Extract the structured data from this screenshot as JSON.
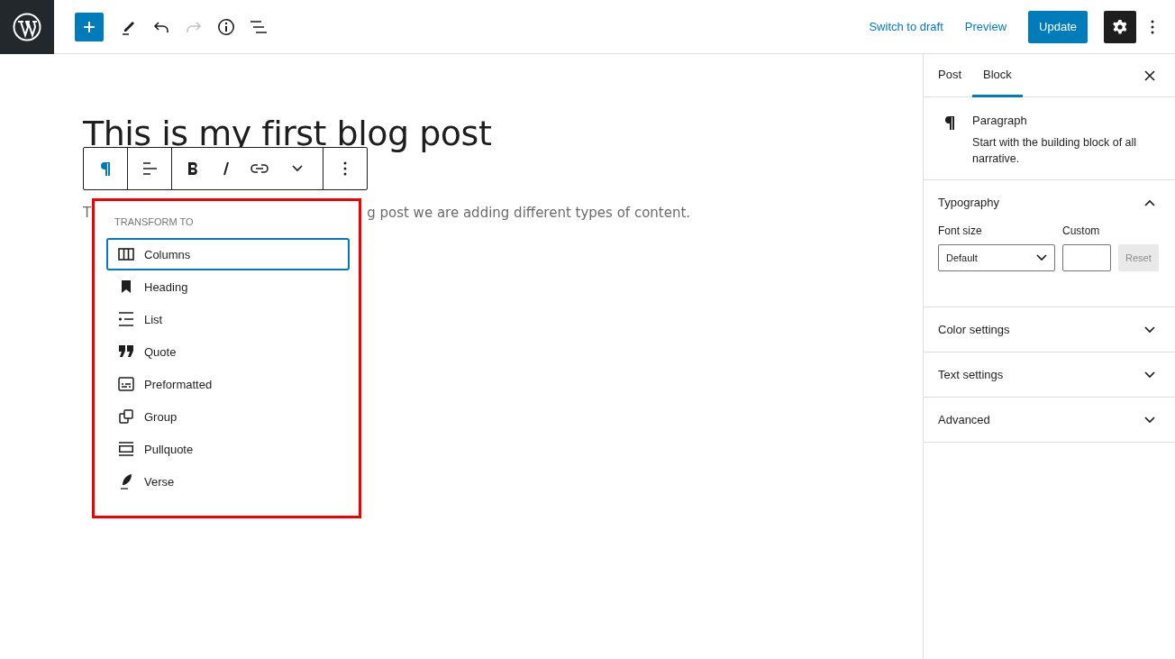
{
  "top_bar": {
    "tools": [
      {
        "kind": "add",
        "disabled": false
      },
      {
        "kind": "edit",
        "disabled": false
      },
      {
        "kind": "undo",
        "disabled": false
      },
      {
        "kind": "redo",
        "disabled": true
      },
      {
        "kind": "info",
        "disabled": false
      },
      {
        "kind": "outline",
        "disabled": false
      }
    ],
    "links": [
      "Switch to draft",
      "Preview"
    ],
    "primary_button": "Update",
    "settings": {
      "pressed": true
    }
  },
  "editor": {
    "title": "This is my first blog post",
    "paragraph": {
      "visible_start": "T",
      "visible_end": "g post we are adding different types of content."
    }
  },
  "block_toolbar": [
    [
      {
        "kind": "paragraph"
      }
    ],
    [
      {
        "kind": "align"
      }
    ],
    [
      {
        "kind": "bold"
      },
      {
        "kind": "italic"
      },
      {
        "kind": "link"
      },
      {
        "kind": "caret"
      }
    ],
    [
      {
        "kind": "options"
      }
    ]
  ],
  "transform_menu": {
    "heading": "TRANSFORM TO",
    "items": [
      {
        "label": "Columns",
        "kind": "columns",
        "selected": true
      },
      {
        "label": "Heading",
        "kind": "heading",
        "selected": false
      },
      {
        "label": "List",
        "kind": "list",
        "selected": false
      },
      {
        "label": "Quote",
        "kind": "quote",
        "selected": false
      },
      {
        "label": "Preformatted",
        "kind": "preformatted",
        "selected": false
      },
      {
        "label": "Group",
        "kind": "group",
        "selected": false
      },
      {
        "label": "Pullquote",
        "kind": "pullquote",
        "selected": false
      },
      {
        "label": "Verse",
        "kind": "verse",
        "selected": false
      }
    ]
  },
  "sidebar": {
    "tabs": [
      {
        "label": "Post",
        "selected": false
      },
      {
        "label": "Block",
        "selected": true
      }
    ],
    "block_card": {
      "title": "Paragraph",
      "description": "Start with the building block of all narrative."
    },
    "panels": [
      {
        "title": "Typography",
        "expanded": true,
        "font_size_label": "Font size",
        "select_value": "Default",
        "custom_label": "Custom",
        "reset": {
          "label": "Reset",
          "disabled": true
        }
      },
      {
        "title": "Color settings",
        "expanded": false
      },
      {
        "title": "Text settings",
        "expanded": false
      },
      {
        "title": "Advanced",
        "expanded": false
      }
    ]
  }
}
